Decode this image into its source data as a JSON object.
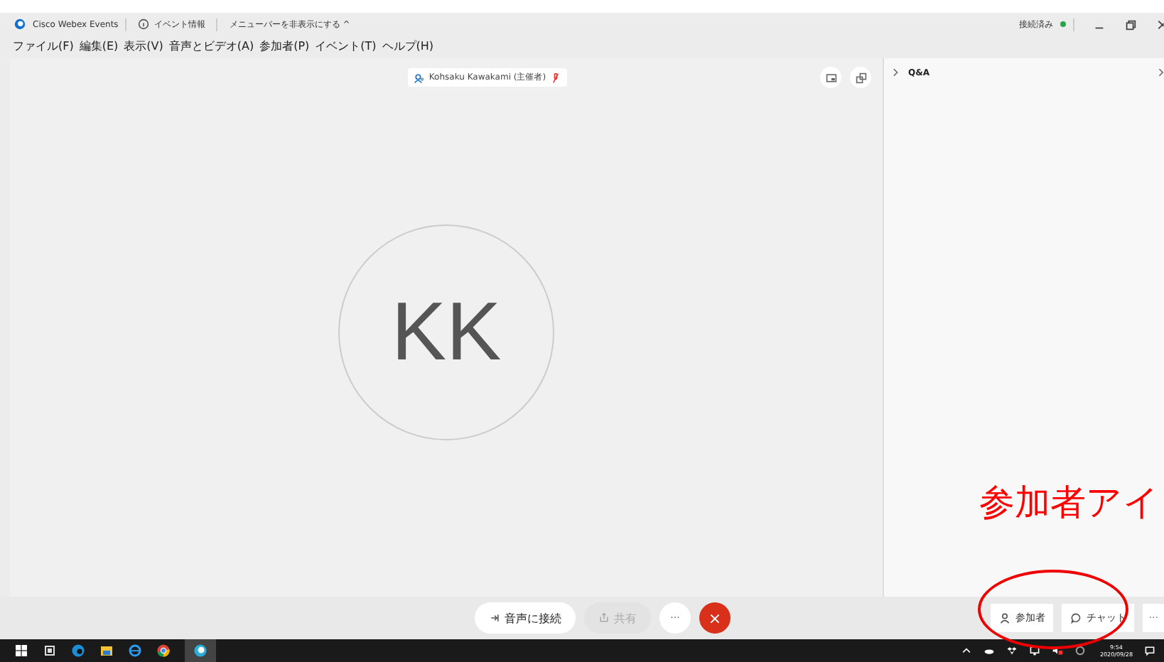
{
  "title_bar": {
    "app_name": "Cisco Webex Events",
    "event_info": "イベント情報",
    "hide_menu": "メニューバーを非表示にする ^",
    "status": "接続済み",
    "connected": true
  },
  "menu": [
    "ファイル(F)",
    "編集(E)",
    "表示(V)",
    "音声とビデオ(A)",
    "参加者(P)",
    "イベント(T)",
    "ヘルプ(H)"
  ],
  "speaker": {
    "name": "Kohsaku Kawakami (主催者)",
    "initials": "KK"
  },
  "panel": {
    "title": "Q&A"
  },
  "controls": [
    {
      "kind": "pill",
      "label": "音声に接続",
      "disabled": false
    },
    {
      "kind": "pill",
      "label": "共有",
      "disabled": true
    },
    {
      "kind": "more",
      "label": "···"
    },
    {
      "kind": "end",
      "label": "×"
    }
  ],
  "right_controls": [
    {
      "kind": "participants",
      "label": "参加者"
    },
    {
      "kind": "chat",
      "label": "チャット"
    },
    {
      "kind": "more",
      "label": "···"
    }
  ],
  "annotation": {
    "text": "参加者アイ"
  },
  "taskbar": {
    "time": "9:54",
    "date": "2020/09/28"
  }
}
